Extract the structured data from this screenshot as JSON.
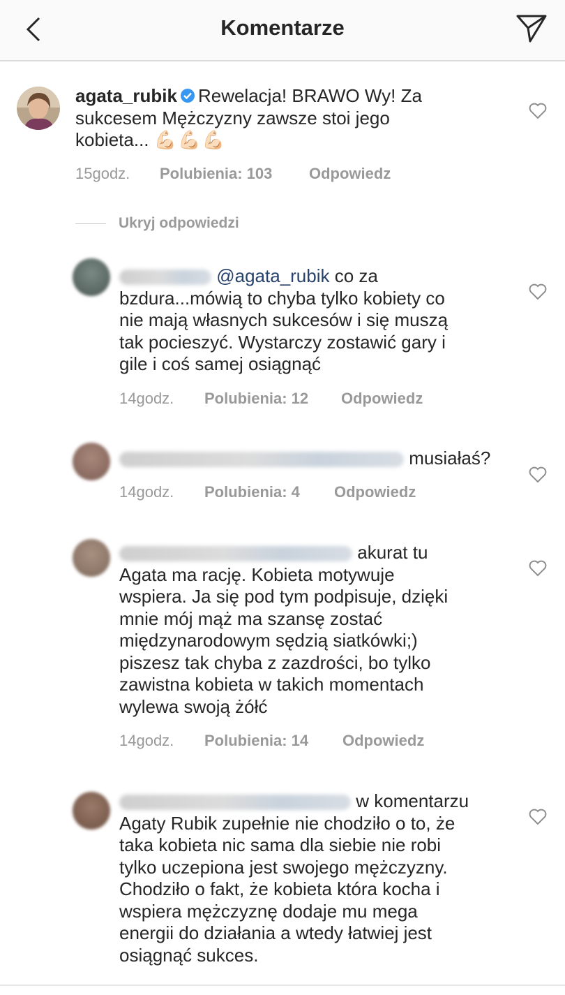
{
  "header": {
    "title": "Komentarze",
    "back_icon": "chevron-left-icon",
    "send_icon": "paper-plane-icon"
  },
  "main_comment": {
    "username": "agata_rubik",
    "verified": true,
    "text_line1": "Rewelacja! BRAWO Wy! Za",
    "text_line2": "sukcesem Mężczyzny zawsze stoi jego",
    "text_line3": "kobieta...",
    "emoji": "💪🏻💪🏻💪🏻",
    "time": "15godz.",
    "likes": "Polubienia: 103",
    "reply": "Odpowiedz"
  },
  "hide_replies": "Ukryj odpowiedzi",
  "replies": [
    {
      "mention": "@agata_rubik",
      "lines": [
        "co za",
        "bzdura...mówią to chyba tylko kobiety co",
        "nie mają własnych sukcesów i się muszą",
        "tak pocieszyć. Wystarczy zostawić gary i",
        "gile i coś samej osiągnąć"
      ],
      "time": "14godz.",
      "likes": "Polubienia: 12",
      "reply": "Odpowiedz"
    },
    {
      "lines": [
        "musiałaś?"
      ],
      "time": "14godz.",
      "likes": "Polubienia: 4",
      "reply": "Odpowiedz"
    },
    {
      "lines": [
        "akurat tu",
        "Agata ma rację. Kobieta motywuje",
        "wspiera. Ja się pod tym podpisuje, dzięki",
        "mnie mój mąż ma szansę zostać",
        "międzynarodowym sędzią siatkówki;)",
        "piszesz tak chyba z zazdrości, bo tylko",
        "zawistna kobieta w takich momentach",
        "wylewa swoją żółć"
      ],
      "time": "14godz.",
      "likes": "Polubienia: 14",
      "reply": "Odpowiedz"
    },
    {
      "lines": [
        "w komentarzu",
        "Agaty Rubik zupełnie nie chodziło o to, że",
        "taka kobieta nic sama dla siebie nie robi",
        "tylko uczepiona jest swojego mężczyzny.",
        "Chodziło o fakt, że kobieta która kocha i",
        "wspiera mężczyznę dodaje mu mega",
        "energii do działania a wtedy łatwiej jest",
        "osiągnąć sukces."
      ]
    }
  ],
  "colors": {
    "meta_gray": "#999999",
    "mention_blue": "#27426b",
    "verified_blue": "#3897f0"
  }
}
